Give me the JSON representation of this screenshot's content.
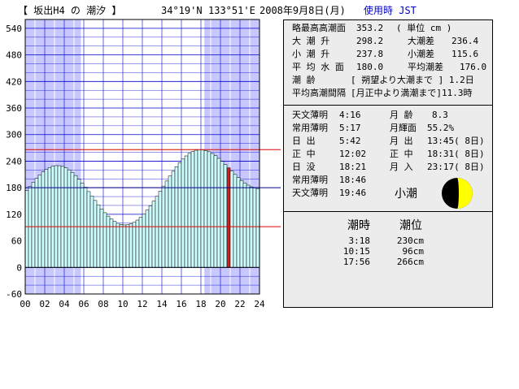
{
  "header": {
    "title": "【 坂出H4 の 潮汐 】",
    "lat": "34°19'N",
    "lon": "133°51'E",
    "date": "2008年9月8日(月)",
    "time_zone": "使用時 JST"
  },
  "info": {
    "rows": [
      {
        "l1": "略最高高潮面",
        "v1": "353.2",
        "l2": "( 単位 cm )",
        "v2": ""
      },
      {
        "l1": "大 潮 升",
        "v1": "298.2",
        "l2": "大潮差",
        "v2": "236.4"
      },
      {
        "l1": "小 潮 升",
        "v1": "237.8",
        "l2": "小潮差",
        "v2": "115.6"
      },
      {
        "l1": "平 均 水 面",
        "v1": "180.0",
        "l2": "平均潮差",
        "v2": "176.0"
      },
      {
        "l1": "潮     齢",
        "v1": "[ 朔望より大潮まで ] 1.2日",
        "l2": "",
        "v2": ""
      },
      {
        "l1": "平均高潮間隔",
        "v1": "[月正中より満潮まで]11.3時",
        "l2": "",
        "v2": ""
      }
    ]
  },
  "astro": {
    "rows": [
      {
        "l1": "天文薄明",
        "v1": "4:16",
        "l2": "月 齢",
        "v2": "8.3"
      },
      {
        "l1": "常用薄明",
        "v1": "5:17",
        "l2": "月輝面",
        "v2": "55.2%"
      },
      {
        "l1": "日   出",
        "v1": "5:42",
        "l2": "月 出",
        "v2": "13:45( 8日)"
      },
      {
        "l1": "正   中",
        "v1": "12:02",
        "l2": "正 中",
        "v2": "18:31( 8日)"
      },
      {
        "l1": "日   没",
        "v1": "18:21",
        "l2": "月 入",
        "v2": "23:17( 8日)"
      },
      {
        "l1": "常用薄明",
        "v1": "18:46",
        "l2": "",
        "v2": ""
      },
      {
        "l1": "天文薄明",
        "v1": "19:46",
        "l2": "",
        "v2": ""
      }
    ],
    "moon_phase_label": "小潮",
    "moon_illumination": 0.552
  },
  "tides": {
    "head_time": "潮時",
    "head_level": "潮位",
    "events": [
      {
        "time": "3:18",
        "level": "230cm"
      },
      {
        "time": "10:15",
        "level": "96cm"
      },
      {
        "time": "17:56",
        "level": "266cm"
      }
    ]
  },
  "colors": {
    "night_shade": "#c8c8ff",
    "bar_fill": "#ccffff",
    "bar_current": "#cc2222",
    "grid": "#0000cc",
    "ref_high": "#dd0000",
    "ref_mean": "#000088",
    "ref_low": "#dd0000"
  },
  "chart_data": {
    "type": "bar",
    "x_ticks": [
      "00",
      "02",
      "04",
      "06",
      "08",
      "10",
      "12",
      "14",
      "16",
      "18",
      "20",
      "22",
      "24"
    ],
    "y_ticks": [
      "540",
      "480",
      "420",
      "360",
      "300",
      "240",
      "180",
      "120",
      "60",
      "0",
      "-60"
    ],
    "ylim": [
      -60,
      560
    ],
    "xlim": [
      0,
      24
    ],
    "grid": true,
    "x_step_hours": 0.33333,
    "current_time_hour": 20.67,
    "night_ranges": [
      [
        0,
        5.7
      ],
      [
        18.35,
        24
      ]
    ],
    "reference_lines": [
      {
        "name": "大潮升",
        "value": 266
      },
      {
        "name": "平均水面",
        "value": 180
      },
      {
        "name": "小潮升",
        "value": 92
      }
    ],
    "tide_events": [
      {
        "hour": 3.3,
        "level": 230
      },
      {
        "hour": 10.25,
        "level": 96
      },
      {
        "hour": 17.93,
        "level": 266
      }
    ],
    "tide_tail": {
      "hour": 24,
      "level": 178
    }
  }
}
